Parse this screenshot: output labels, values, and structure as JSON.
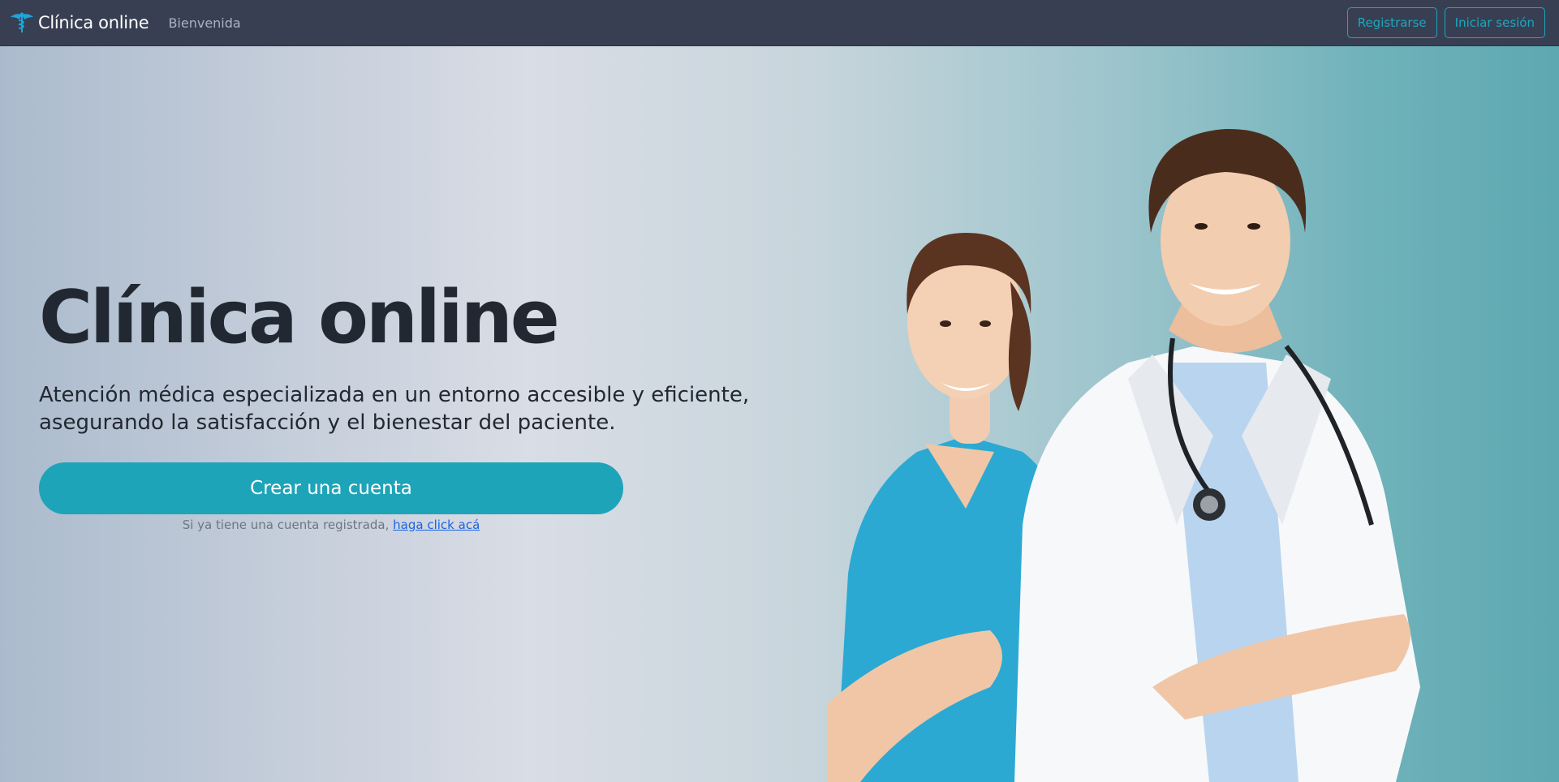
{
  "navbar": {
    "brand": "Clínica online",
    "links": [
      "Bienvenida"
    ],
    "register_label": "Registrarse",
    "login_label": "Iniciar sesión",
    "brand_icon": "caduceus-icon"
  },
  "hero": {
    "title": "Clínica online",
    "lead": "Atención médica especializada en un entorno accesible y eficiente, asegurando la satisfacción y el bienestar del paciente.",
    "cta_label": "Crear una cuenta",
    "login_hint": "Si ya tiene una cuenta registrada,",
    "login_link": "haga click acá"
  },
  "colors": {
    "navbar_bg": "#383f52",
    "accent": "#1ea4b8",
    "title": "#222831",
    "link": "#1b63e0"
  }
}
